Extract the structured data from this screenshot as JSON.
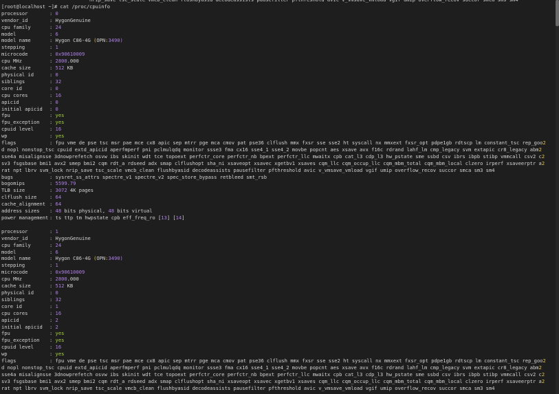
{
  "header_line": "nrip_save tsc_scale vmcb_clean flushbyasid decodeassists pausefilter pfthreshold avic v_vmsave_vmload vgif umip overflow_recov succor smca sms sm4",
  "prompt": "[root@localhost ~]# ",
  "command": "cat /proc/cpuinfo",
  "processors": [
    {
      "processor": "0",
      "vendor_id": "HygonGenuine",
      "cpu_family": "24",
      "model": "6",
      "model_name": "Hygon C86-4G (OPN:3490)",
      "stepping": "1",
      "microcode": "0x90610009",
      "cpu_mhz": "2800.000",
      "cache_size": "512 KB",
      "physical_id": "0",
      "siblings": "32",
      "core_id": "0",
      "cpu_cores": "16",
      "apicid": "0",
      "initial_apicid": "0",
      "fpu": "yes",
      "fpu_exception": "yes",
      "cpuid_level": "16",
      "wp": "yes",
      "bogomips": "5599.79",
      "tlb_size": "3072 4K pages",
      "clflush_size": "64",
      "cache_alignment": "64",
      "address_sizes": "48 bits physical, 48 bits virtual"
    },
    {
      "processor": "1",
      "vendor_id": "HygonGenuine",
      "cpu_family": "24",
      "model": "6",
      "model_name": "Hygon C86-4G (OPN:3490)",
      "stepping": "1",
      "microcode": "0x90610009",
      "cpu_mhz": "2800.000",
      "cache_size": "512 KB",
      "physical_id": "0",
      "siblings": "32",
      "core_id": "1",
      "cpu_cores": "16",
      "apicid": "2",
      "initial_apicid": "2",
      "fpu": "yes",
      "fpu_exception": "yes",
      "cpuid_level": "16",
      "wp": "yes"
    }
  ],
  "flags_lines": [
    "fpu vme de pse tsc msr pae mce cx8 apic sep mtrr pge mca cmov pat pse36 clflush mmx fxsr sse sse2 ht syscall nx mmxext fxsr_opt pdpe1gb rdtscp lm constant_tsc rep_goo",
    "d nopl nonstop_tsc cpuid extd_apicid aperfmperf pni pclmulqdq monitor ssse3 fma cx16 sse4_1 sse4_2 movbe popcnt aes xsave avx f16c rdrand lahf_lm cmp_legacy svm extapic cr8_legacy abm",
    "sse4a misalignsse 3dnowprefetch osvw ibs skinit wdt tce topoext perfctr_core perfctr_nb bpext perfctr_llc mwaitx cpb cat_l3 cdp_l3 hw_pstate sme ssbd csv ibrs ibpb stibp vmmcall csv2 c",
    "sv3 fsgsbase bmi1 avx2 smep bmi2 cqm rdt_a rdseed adx smap clflushopt sha_ni xsaveopt xsavec xgetbv1 xsaves cqm_llc cqm_occup_llc cqm_mbm_total cqm_mbm_local clzero irperf xsaveerptr a",
    "rat npt lbrv svm_lock nrip_save tsc_scale vmcb_clean flushbyasid decodeassists pausefilter pfthreshold avic v_vmsave_vmload vgif umip overflow_recov succor smca sm3 sm4"
  ],
  "wrap_marks": [
    "2",
    "2",
    "2",
    "2"
  ],
  "bugs": "sysret_ss_attrs spectre_v1 spectre_v2 spec_store_bypass retbleed smt_rsb",
  "power_management": "ts ttp tm hwpstate cpb eff_freq_ro [13] [14]",
  "labels": {
    "processor": "processor",
    "vendor_id": "vendor_id",
    "cpu_family": "cpu family",
    "model": "model",
    "model_name": "model name",
    "stepping": "stepping",
    "microcode": "microcode",
    "cpu_mhz": "cpu MHz",
    "cache_size": "cache size",
    "physical_id": "physical id",
    "siblings": "siblings",
    "core_id": "core id",
    "cpu_cores": "cpu cores",
    "apicid": "apicid",
    "initial_apicid": "initial apicid",
    "fpu": "fpu",
    "fpu_exception": "fpu_exception",
    "cpuid_level": "cpuid level",
    "wp": "wp",
    "flags": "flags",
    "bugs": "bugs",
    "bogomips": "bogomips",
    "tlb_size": "TLB size",
    "clflush_size": "clflush size",
    "cache_alignment": "cache_alignment",
    "address_sizes": "address sizes",
    "power_management": "power management"
  },
  "separator": ": ",
  "colors": {
    "background": "#1e1e1e",
    "text": "#d4d4d4",
    "number": "#b180e8",
    "yes": "#a6d13a",
    "sep_flag": "#e8c540",
    "microcode": "#5fc4ff"
  }
}
